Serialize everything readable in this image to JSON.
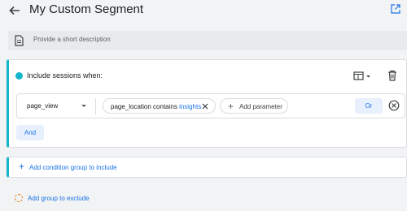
{
  "header": {
    "title": "My Custom Segment"
  },
  "description": {
    "placeholder": "Provide a short description"
  },
  "include_card": {
    "title": "Include sessions when:",
    "accent_color": "#12b5cb",
    "condition": {
      "event": "page_view",
      "chip_prefix": "page_location contains",
      "chip_value": "insights",
      "add_parameter_label": "Add parameter",
      "or_label": "Or"
    },
    "and_label": "And"
  },
  "add_condition_group_label": "Add condition group to include",
  "add_exclude_group_label": "Add group to exclude",
  "colors": {
    "link_blue": "#1a73e8",
    "exclude_orange": "#e37400"
  }
}
